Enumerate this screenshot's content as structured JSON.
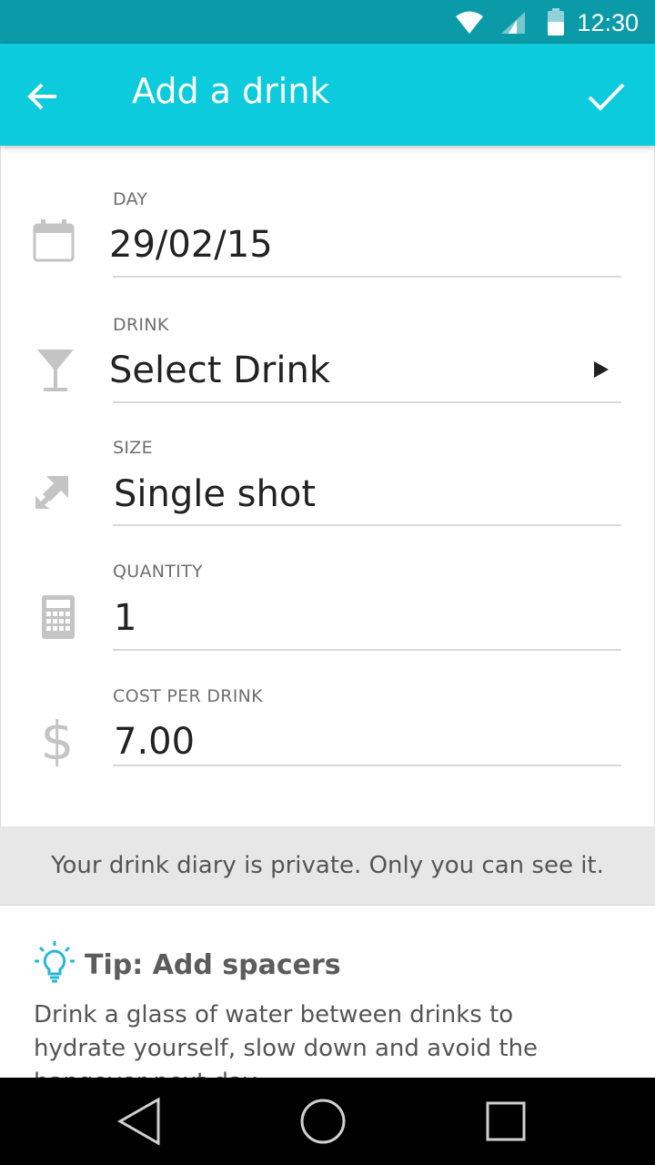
{
  "status_bar": {
    "time": "12:30"
  },
  "app_bar": {
    "title": "Add a drink"
  },
  "fields": {
    "day": {
      "label": "DAY",
      "value": "29/02/15"
    },
    "drink": {
      "label": "DRINK",
      "value": "Select Drink"
    },
    "size": {
      "label": "SIZE",
      "value": "Single shot"
    },
    "quantity": {
      "label": "QUANTITY",
      "value": "1"
    },
    "cost": {
      "label": "COST PER DRINK",
      "value": "7.00"
    }
  },
  "privacy_note": "Your drink diary is private. Only you can see it.",
  "tip": {
    "title": "Tip: Add spacers",
    "body": "Drink a glass of water between drinks to hydrate yourself, slow down and avoid the hangover next day."
  },
  "colors": {
    "status_bar": "#0a9aa8",
    "app_bar": "#0bcbdc",
    "tip_icon": "#29b6d6"
  },
  "icons": [
    "wifi-icon",
    "signal-icon",
    "battery-icon",
    "back-arrow-icon",
    "check-icon",
    "calendar-icon",
    "cocktail-icon",
    "resize-icon",
    "calculator-icon",
    "dollar-icon",
    "lightbulb-icon",
    "back-nav-icon",
    "home-nav-icon",
    "recents-nav-icon"
  ]
}
